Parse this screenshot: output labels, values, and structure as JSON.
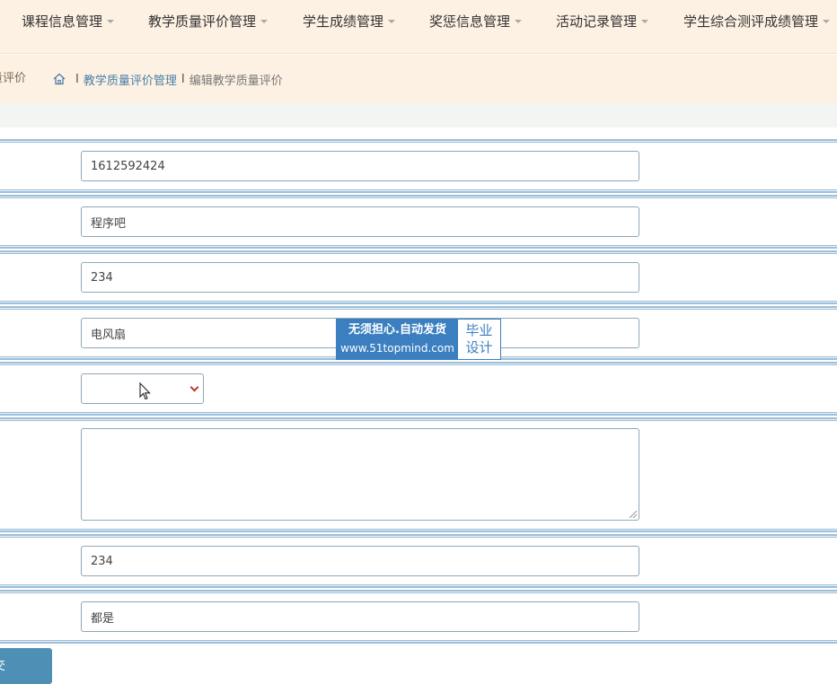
{
  "nav": {
    "items": [
      {
        "label": "课程信息管理"
      },
      {
        "label": "教学质量评价管理"
      },
      {
        "label": "学生成绩管理"
      },
      {
        "label": "奖惩信息管理"
      },
      {
        "label": "活动记录管理"
      },
      {
        "label": "学生综合测评成绩管理"
      }
    ]
  },
  "breadcrumb": {
    "left_fragment": "量评价",
    "section": "教学质量评价管理",
    "separator": "I",
    "current": "编辑教学质量评价"
  },
  "form": {
    "fields": [
      {
        "value": "1612592424"
      },
      {
        "value": "程序吧"
      },
      {
        "value": "234"
      },
      {
        "value": "电风扇"
      },
      {
        "value": ""
      },
      {
        "value": ""
      },
      {
        "value": "234"
      },
      {
        "value": "都是"
      }
    ],
    "submit_label": "提交"
  },
  "watermark": {
    "line1": "无须担心.自动发货",
    "line2": "www.51topmind.com",
    "right1": "毕业",
    "right2": "设计"
  },
  "colors": {
    "nav_bg": "#fdf1e3",
    "accent": "#4d8fb5",
    "row_border": "#9dbfd9",
    "link": "#4a7ea8"
  }
}
